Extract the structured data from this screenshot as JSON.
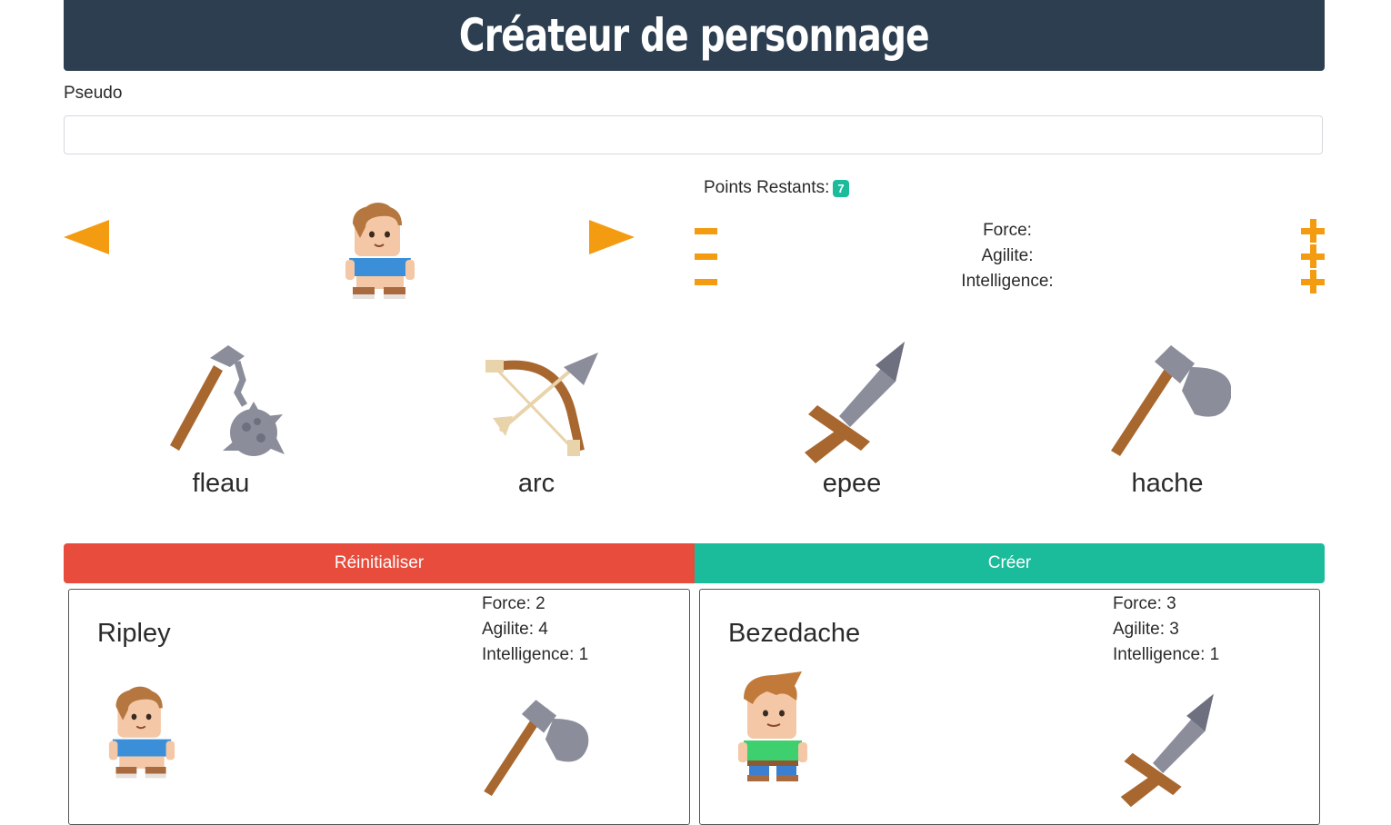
{
  "header": {
    "title": "Créateur de personnage"
  },
  "form": {
    "pseudo_label": "Pseudo",
    "pseudo_value": "",
    "pseudo_placeholder": ""
  },
  "points": {
    "label": "Points Restants:",
    "value": "7"
  },
  "stats": {
    "force_label": "Force:",
    "agilite_label": "Agilite:",
    "intelligence_label": "Intelligence:"
  },
  "weapons": [
    {
      "label": "fleau",
      "icon": "flail-icon"
    },
    {
      "label": "arc",
      "icon": "bow-icon"
    },
    {
      "label": "epee",
      "icon": "sword-icon"
    },
    {
      "label": "hache",
      "icon": "axe-icon"
    }
  ],
  "buttons": {
    "reset": "Réinitialiser",
    "create": "Créer"
  },
  "characters": [
    {
      "name": "Ripley",
      "force": "Force: 2",
      "agilite": "Agilite: 4",
      "intelligence": "Intelligence: 1",
      "avatar": "girl-avatar-icon",
      "weapon": "axe-icon"
    },
    {
      "name": "Bezedache",
      "force": "Force: 3",
      "agilite": "Agilite: 3",
      "intelligence": "Intelligence: 1",
      "avatar": "boy-avatar-icon",
      "weapon": "sword-icon"
    }
  ],
  "colors": {
    "header": "#2c3e50",
    "accent": "#f39c12",
    "danger": "#e74c3c",
    "success": "#1abc9c"
  }
}
